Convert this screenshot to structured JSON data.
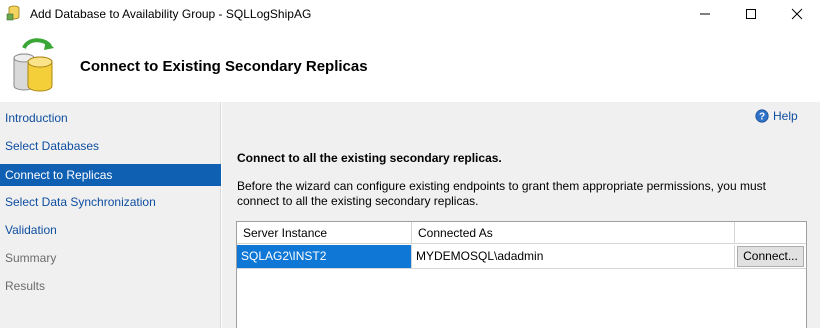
{
  "window": {
    "title": "Add Database to Availability Group - SQLLogShipAG",
    "minimize_glyph": "—",
    "maximize_glyph": "☐",
    "close_glyph": "✕"
  },
  "header": {
    "title": "Connect to Existing Secondary Replicas",
    "icon": "database-sync-icon"
  },
  "sidebar": {
    "items": [
      {
        "label": "Introduction",
        "state": "link"
      },
      {
        "label": "Select Databases",
        "state": "link"
      },
      {
        "label": "Connect to Replicas",
        "state": "active"
      },
      {
        "label": "Select Data Synchronization",
        "state": "link"
      },
      {
        "label": "Validation",
        "state": "link"
      },
      {
        "label": "Summary",
        "state": "disabled"
      },
      {
        "label": "Results",
        "state": "disabled"
      }
    ]
  },
  "main": {
    "help_label": "Help",
    "section_title": "Connect to all the existing secondary replicas.",
    "description": "Before the wizard can configure existing endpoints to grant them appropriate permissions, you must connect to all the existing secondary replicas.",
    "grid": {
      "columns": [
        "Server Instance",
        "Connected As",
        ""
      ],
      "rows": [
        {
          "server_instance": "SQLAG2\\INST2",
          "connected_as": "MYDEMOSQL\\adadmin",
          "action_label": "Connect..."
        }
      ]
    }
  },
  "colors": {
    "accent": "#0f5fb3",
    "selection": "#0f78d7",
    "link": "#0f4ea0",
    "panel_bg": "#f0f0f0"
  }
}
